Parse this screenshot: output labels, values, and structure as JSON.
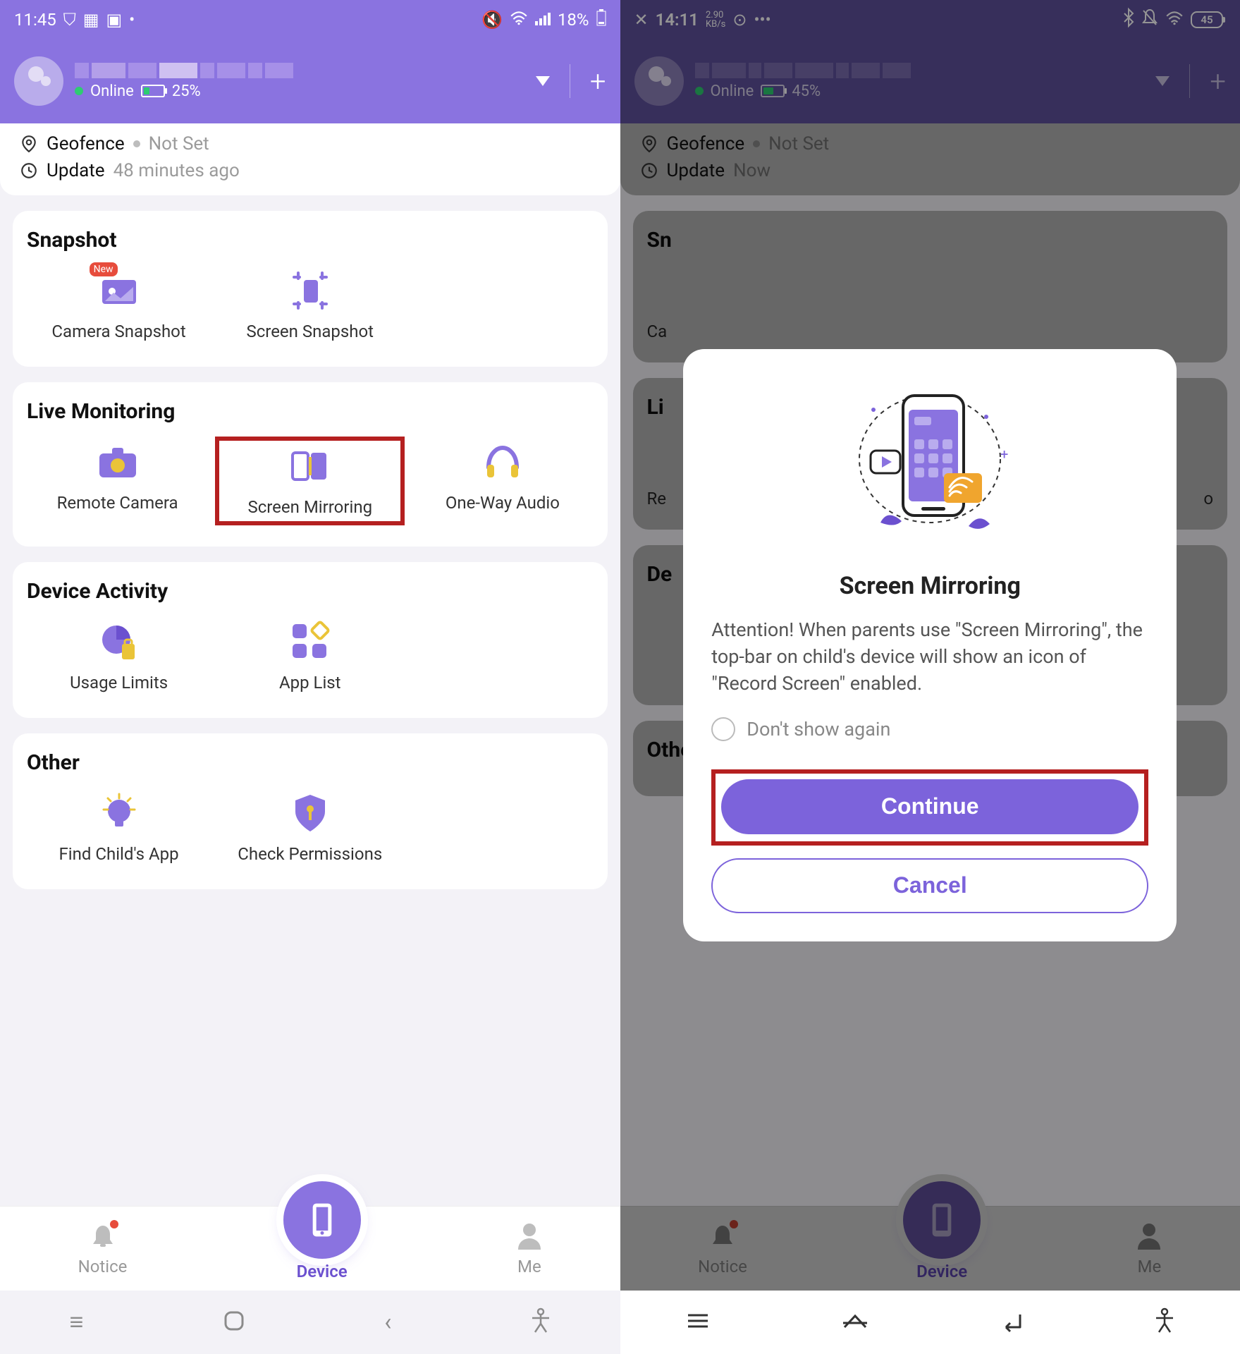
{
  "left": {
    "status": {
      "time": "11:45",
      "battery": "18%"
    },
    "header": {
      "online": "Online",
      "battery_pct": "25%"
    },
    "info": {
      "geofence_label": "Geofence",
      "geofence_value": "Not Set",
      "update_label": "Update",
      "update_value": "48 minutes ago"
    },
    "sections": {
      "snapshot": {
        "title": "Snapshot",
        "items": [
          {
            "label": "Camera Snapshot",
            "badge": "New"
          },
          {
            "label": "Screen Snapshot"
          }
        ]
      },
      "live": {
        "title": "Live Monitoring",
        "items": [
          {
            "label": "Remote Camera"
          },
          {
            "label": "Screen Mirroring"
          },
          {
            "label": "One-Way Audio"
          }
        ]
      },
      "activity": {
        "title": "Device Activity",
        "items": [
          {
            "label": "Usage Limits"
          },
          {
            "label": "App List"
          }
        ]
      },
      "other": {
        "title": "Other",
        "items": [
          {
            "label": "Find Child's App"
          },
          {
            "label": "Check Permissions"
          }
        ]
      }
    },
    "nav": {
      "notice": "Notice",
      "device": "Device",
      "me": "Me"
    }
  },
  "right": {
    "status": {
      "time": "14:11",
      "net": "2.90",
      "net_unit": "KB/s",
      "battery": "45"
    },
    "header": {
      "online": "Online",
      "battery_pct": "45%"
    },
    "info": {
      "geofence_label": "Geofence",
      "geofence_value": "Not Set",
      "update_label": "Update",
      "update_value": "Now"
    },
    "sections": {
      "other_title": "Other"
    },
    "modal": {
      "title": "Screen Mirroring",
      "body": "Attention! When parents use \"Screen Mirroring\", the top-bar on child's device will show an icon of \"Record Screen\" enabled.",
      "dont_show": "Don't show again",
      "continue": "Continue",
      "cancel": "Cancel"
    },
    "nav": {
      "notice": "Notice",
      "device": "Device",
      "me": "Me"
    },
    "bg_labels": {
      "sn": "Sn",
      "ca": "Ca",
      "li": "Li",
      "re": "Re",
      "de": "De",
      "o": "o"
    }
  }
}
